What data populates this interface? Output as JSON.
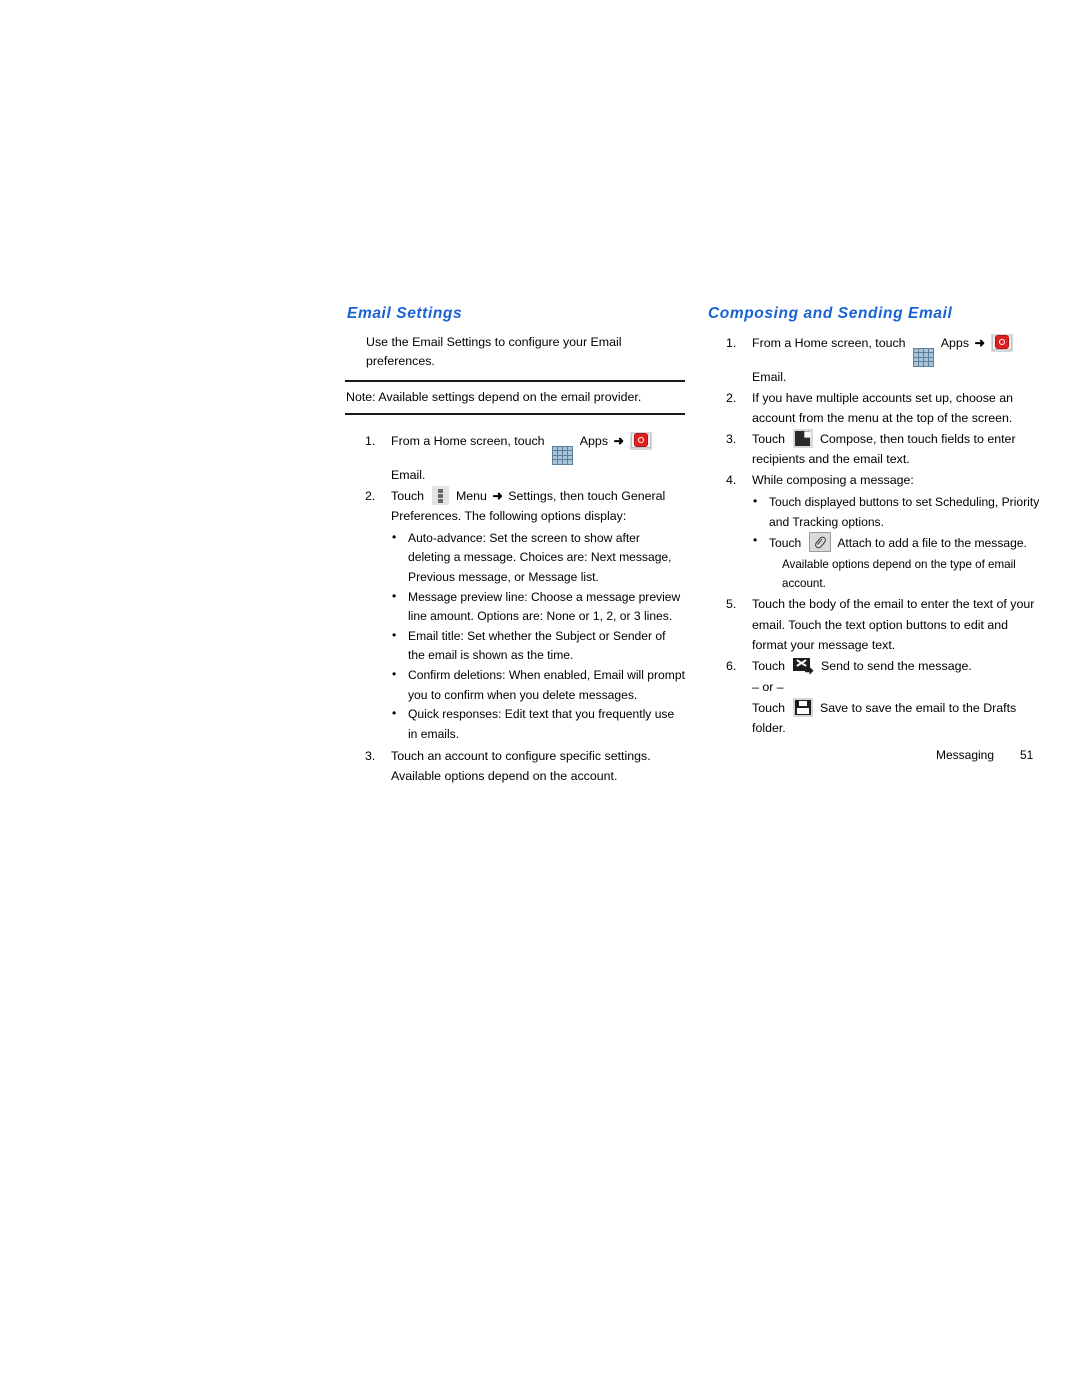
{
  "document": {
    "footer": {
      "chapter": "Messaging",
      "page_number": "51"
    },
    "accent_color": "#1763d6"
  },
  "left_column": {
    "heading": "Email Settings",
    "intro": "Use the Email Settings to configure your Email preferences.",
    "note": "Note: Available settings depend on the email provider.",
    "steps": [
      {
        "number": "1.",
        "segments": {
          "before_apps": "From a Home screen, touch ",
          "apps_label": " Apps ",
          "arrow": "➜",
          "email_label": " Email."
        }
      },
      {
        "number": "2.",
        "segments": {
          "touch": "Touch ",
          "menu_label": " Menu ",
          "arrow": "➜",
          "after_menu": " Settings, then touch General Preferences. The following options display:"
        },
        "bullets": [
          "Auto-advance: Set the screen to show after deleting a message. Choices are: Next message, Previous message, or Message list.",
          "Message preview line: Choose a message preview line amount. Options are: None or 1, 2, or 3 lines.",
          "Email title: Set whether the Subject or Sender of the email is shown as the time.",
          "Confirm deletions: When enabled, Email will prompt you to confirm when you delete messages.",
          "Quick responses: Edit text that you frequently use in emails."
        ]
      },
      {
        "number": "3.",
        "text": "Touch an account to configure specific settings. Available options depend on the account."
      }
    ]
  },
  "right_column": {
    "heading": "Composing and Sending Email",
    "steps": [
      {
        "number": "1.",
        "segments": {
          "before_apps": "From a Home screen, touch ",
          "apps_label": " Apps ",
          "arrow": "➜",
          "email_label": " Email."
        }
      },
      {
        "number": "2.",
        "text": "If you have multiple accounts set up, choose an account from the menu at the top of the screen."
      },
      {
        "number": "3.",
        "segments": {
          "touch": "Touch ",
          "after_icon": " Compose, then touch fields to enter recipients and the email text."
        }
      },
      {
        "number": "4.",
        "text": "While composing a message:",
        "bullets": [
          {
            "text": "Touch displayed buttons to set Scheduling, Priority and Tracking options.",
            "has_icon": false
          },
          {
            "before_icon": "Touch ",
            "after_icon": " Attach to add a file to the message.",
            "has_icon": true
          }
        ],
        "sub_note": "Available options depend on the type of email account."
      },
      {
        "number": "5.",
        "text": "Touch the body of the email to enter the text of your email. Touch the text option buttons to edit and format your message text."
      },
      {
        "number": "6.",
        "segments": {
          "touch": "Touch ",
          "after_send": " Send to send the message.",
          "or": "– or –",
          "save_touch": "Touch ",
          "after_save": " Save to save the email to the Drafts folder."
        }
      }
    ]
  },
  "icons": {
    "apps": "apps-grid-icon",
    "email": "email-envelope-icon",
    "menu": "menu-vertical-dots-icon",
    "compose": "compose-pencil-icon",
    "attach": "attach-paperclip-icon",
    "send": "send-envelope-icon",
    "save": "save-floppy-icon"
  }
}
